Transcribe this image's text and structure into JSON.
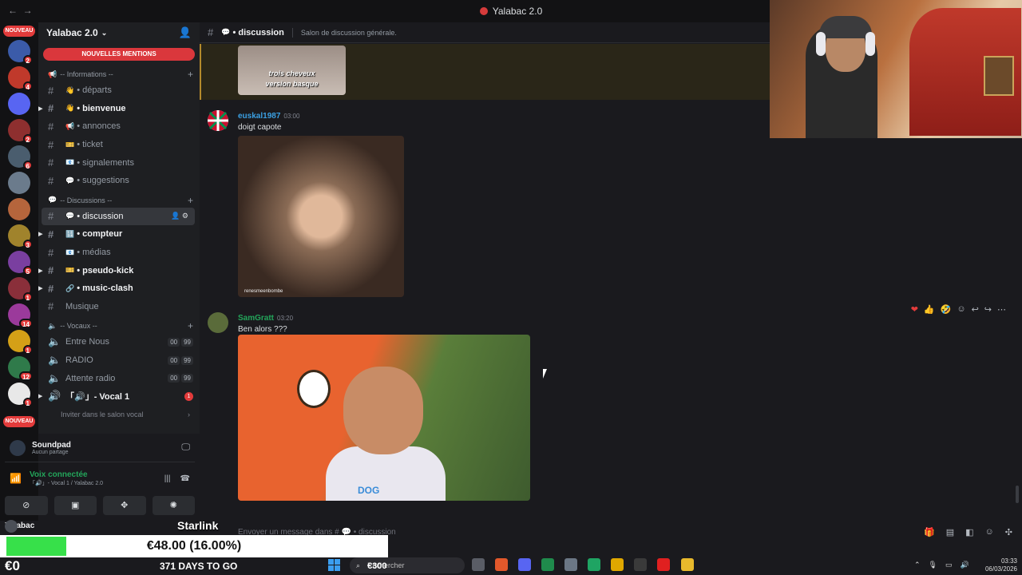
{
  "window": {
    "title": "Yalabac 2.0"
  },
  "servers": {
    "new_top": "NOUVEAU",
    "new_bottom": "NOUVEAU",
    "items": [
      {
        "color": "#3b5ba9",
        "badge": "2"
      },
      {
        "color": "#c0392b",
        "badge": "4"
      },
      {
        "color": "#5865f2",
        "badge": ""
      },
      {
        "color": "#8e2f2f",
        "badge": "2"
      },
      {
        "color": "#4a5d6e",
        "badge": "6"
      },
      {
        "color": "#6b7b8c",
        "badge": ""
      },
      {
        "color": "#b5653c",
        "badge": ""
      },
      {
        "color": "#a0832c",
        "badge": "3"
      },
      {
        "color": "#7a3fa0",
        "badge": "5"
      },
      {
        "color": "#8a2f3a",
        "badge": "1"
      },
      {
        "color": "#9b3a9b",
        "badge": "14"
      },
      {
        "color": "#d4a017",
        "badge": "1"
      },
      {
        "color": "#2f7a4a",
        "badge": "12"
      },
      {
        "color": "#e8e8e8",
        "badge": "1"
      }
    ]
  },
  "sidebar": {
    "guild_name": "Yalabac 2.0",
    "new_mentions": "NOUVELLES MENTIONS",
    "categories": {
      "info": "-- Informations --",
      "discussions": "-- Discussions --",
      "vocaux": "-- Vocaux --"
    },
    "channels": [
      {
        "emoji": "👋",
        "name": "• départs",
        "bold": false
      },
      {
        "emoji": "👋",
        "name": "• bienvenue",
        "bold": true
      },
      {
        "emoji": "📢",
        "name": "• annonces",
        "bold": false
      },
      {
        "emoji": "🎫",
        "name": "• ticket",
        "bold": false
      },
      {
        "emoji": "📧",
        "name": "• signalements",
        "bold": false
      },
      {
        "emoji": "💬",
        "name": "• suggestions",
        "bold": false
      }
    ],
    "discussion_channels": [
      {
        "emoji": "💬",
        "name": "• discussion",
        "active": true
      },
      {
        "emoji": "🔢",
        "name": "• compteur",
        "bold": true
      },
      {
        "emoji": "📧",
        "name": "• médias",
        "bold": false
      },
      {
        "emoji": "🎫",
        "name": "• pseudo-kick",
        "bold": true
      },
      {
        "emoji": "🔗",
        "name": "• music-clash",
        "bold": true
      },
      {
        "emoji": "",
        "name": "Musique",
        "bold": false
      }
    ],
    "voice_channels": [
      {
        "name": "Entre Nous",
        "c1": "00",
        "c2": "99"
      },
      {
        "name": "RADIO",
        "c1": "00",
        "c2": "99"
      },
      {
        "name": "Attente radio",
        "c1": "00",
        "c2": "99"
      }
    ],
    "vocal1": {
      "name": "「🔊」- Vocal 1",
      "badge": "1"
    },
    "invite_voice": "Inviter dans le salon vocal"
  },
  "userpanel": {
    "soundpad_title": "Soundpad",
    "soundpad_sub": "Aucun partage",
    "voice_title": "Voix connectée",
    "voice_sub": "「🔊」- Vocal 1 / Yalabac 2.0",
    "username": "Yalabac"
  },
  "main": {
    "channel_name": "• discussion",
    "channel_desc": "Salon de discussion générale.",
    "img1_caption_1": "trois cheveux",
    "img1_caption_2": "version basque",
    "messages": [
      {
        "author": "euskal1987",
        "time": "03:00",
        "text": "doigt capote",
        "color": "#3ba0e3"
      },
      {
        "author": "SamGratt",
        "time": "03:20",
        "text": "Ben alors ???",
        "color": "#23a55a"
      }
    ],
    "img2_watermark": "renesmeenbombe",
    "img3_shirt": "DOG",
    "composer_placeholder": "Envoyer un message dans # 💬 • discussion"
  },
  "overlay": {
    "donation": "€48.00 (16.00%)",
    "donation_progress": 0.16,
    "starlink": "Starlink",
    "balance": "€0",
    "days": "371 DAYS TO GO",
    "target": "€300"
  },
  "taskbar": {
    "search_placeholder": "Rechercher",
    "time": "03:33",
    "date": "06/03/2026"
  }
}
